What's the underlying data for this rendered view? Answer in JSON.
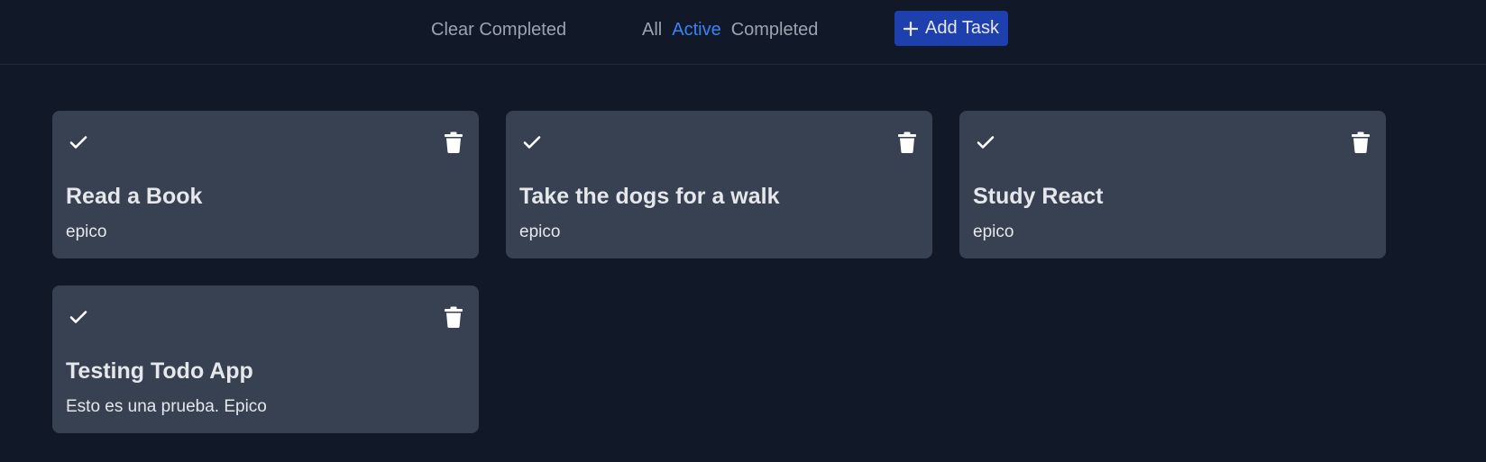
{
  "header": {
    "clear_label": "Clear Completed",
    "filters": [
      {
        "label": "All",
        "active": false
      },
      {
        "label": "Active",
        "active": true
      },
      {
        "label": "Completed",
        "active": false
      }
    ],
    "add_label": "Add Task"
  },
  "tasks": [
    {
      "title": "Read a Book",
      "description": "epico"
    },
    {
      "title": "Take the dogs for a walk",
      "description": "epico"
    },
    {
      "title": "Study React",
      "description": "epico"
    },
    {
      "title": "Testing Todo App",
      "description": "Esto es una prueba. Epico"
    }
  ],
  "icons": {
    "check": "check-icon",
    "trash": "trash-icon",
    "plus": "plus-icon"
  },
  "colors": {
    "background": "#111827",
    "card": "#374151",
    "accent": "#3b82f6",
    "button": "#1e40af",
    "muted_text": "#9ca3af",
    "text": "#e5e7eb"
  }
}
